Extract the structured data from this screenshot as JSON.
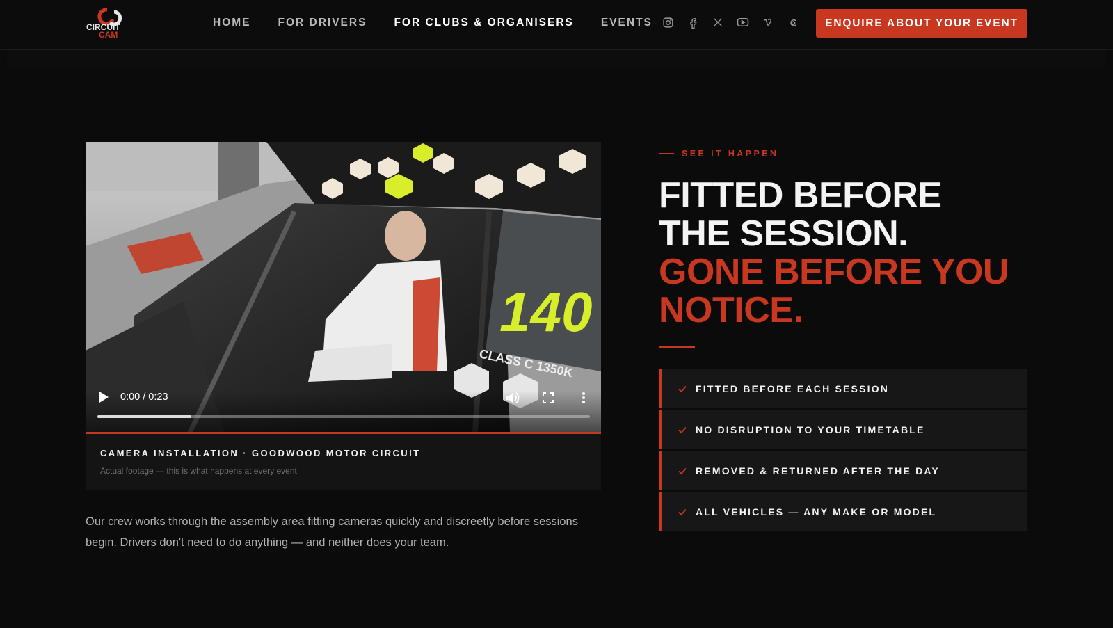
{
  "brand": {
    "logo_text_top": "CIRCUIT",
    "logo_text_bottom": "CAM"
  },
  "nav": {
    "items": [
      {
        "label": "HOME",
        "active": false
      },
      {
        "label": "FOR DRIVERS",
        "active": false
      },
      {
        "label": "FOR CLUBS & ORGANISERS",
        "active": true
      },
      {
        "label": "EVENTS",
        "active": false
      }
    ],
    "socials": [
      "instagram-icon",
      "facebook-icon",
      "x-icon",
      "youtube-icon",
      "vimeo-icon",
      "threads-icon"
    ],
    "cta_label": "ENQUIRE ABOUT YOUR EVENT"
  },
  "video": {
    "time_display": "0:00 / 0:23",
    "progress_fraction": 0.19,
    "scene_text": "140",
    "scene_class_text": "CLASS C 1350K",
    "caption_title": "CAMERA INSTALLATION · GOODWOOD MOTOR CIRCUIT",
    "caption_subtitle": "Actual footage — this is what happens at every event"
  },
  "body_text": "Our crew works through the assembly area fitting cameras quickly and discreetly before sessions begin. Drivers don't need to do anything — and neither does your team.",
  "section": {
    "eyebrow": "SEE IT HAPPEN",
    "headline_white_line1": "FITTED BEFORE",
    "headline_white_line2": "THE SESSION.",
    "headline_red_line1": "GONE BEFORE YOU",
    "headline_red_line2": "NOTICE.",
    "features": [
      {
        "label": "FITTED BEFORE EACH SESSION"
      },
      {
        "label": "NO DISRUPTION TO YOUR TIMETABLE"
      },
      {
        "label": "REMOVED & RETURNED AFTER THE DAY"
      },
      {
        "label": "ALL VEHICLES — ANY MAKE OR MODEL"
      }
    ]
  },
  "colors": {
    "accent": "#c8371f",
    "background": "#0b0b0b",
    "card": "#171717",
    "neon": "#d8ee2a"
  }
}
